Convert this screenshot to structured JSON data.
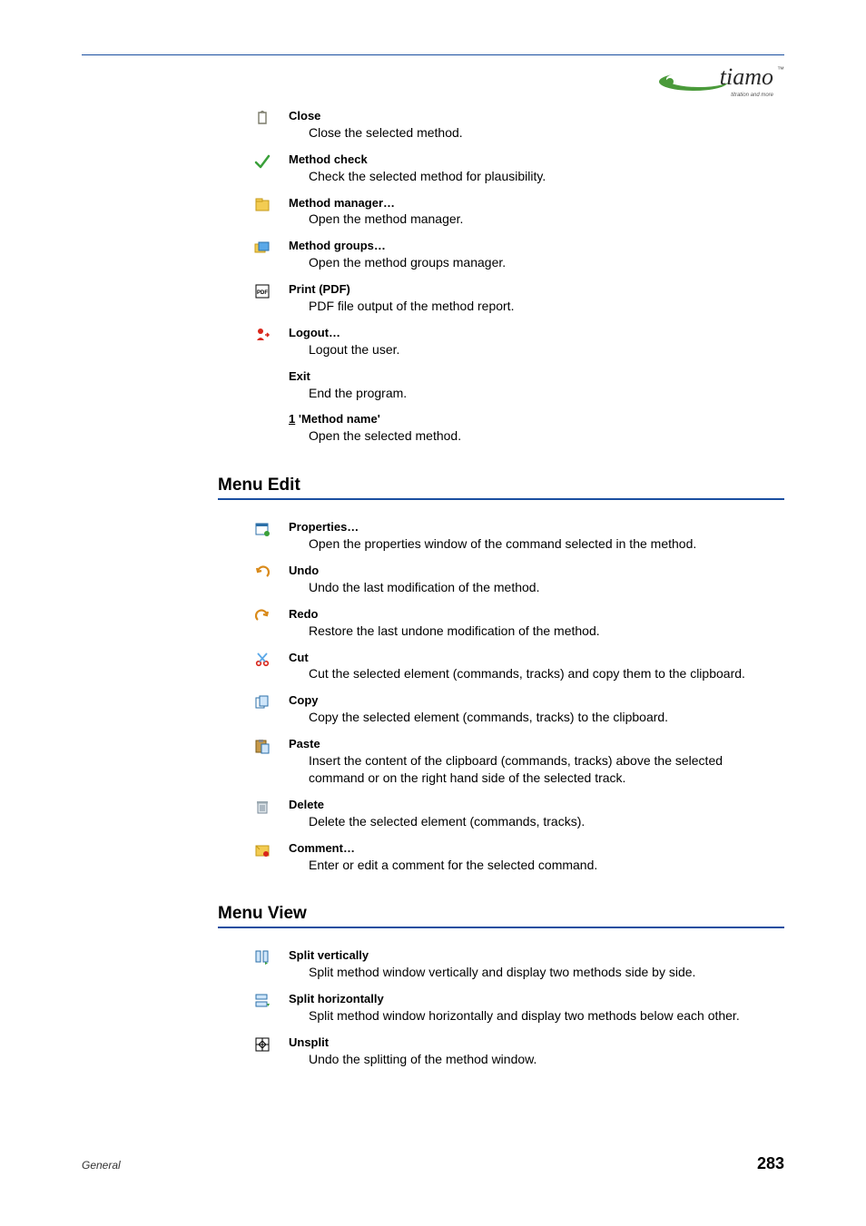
{
  "logo": {
    "text": "tiamo",
    "tm": "™",
    "sub": "titration and more"
  },
  "menu_file_extra": [
    {
      "icon": "close-icon",
      "title": "Close",
      "desc": "Close the selected method."
    },
    {
      "icon": "method-check-icon",
      "title": "Method check",
      "desc": "Check the selected method for plausibility."
    },
    {
      "icon": "method-manager-icon",
      "title": "Method manager…",
      "desc": "Open the method manager."
    },
    {
      "icon": "method-groups-icon",
      "title": "Method groups…",
      "desc": "Open the method groups manager."
    },
    {
      "icon": "pdf-icon",
      "title": "Print (PDF)",
      "desc": "PDF file output of the method report."
    },
    {
      "icon": "logout-icon",
      "title": "Logout…",
      "desc": "Logout the user."
    },
    {
      "icon": "",
      "title": "Exit",
      "desc": "End the program."
    },
    {
      "icon": "",
      "title_html": "1 'Method name'",
      "title_prefix": "1",
      "title_rest": " 'Method name'",
      "desc": "Open the selected method."
    }
  ],
  "menu_edit": {
    "heading": "Menu Edit",
    "items": [
      {
        "icon": "properties-icon",
        "title": "Properties…",
        "desc": "Open the properties window of the command selected in the method."
      },
      {
        "icon": "undo-icon",
        "title": "Undo",
        "desc": "Undo the last modification of the method."
      },
      {
        "icon": "redo-icon",
        "title": "Redo",
        "desc": "Restore the last undone modification of the method."
      },
      {
        "icon": "cut-icon",
        "title": "Cut",
        "desc": "Cut the selected element (commands, tracks) and copy them to the clipboard."
      },
      {
        "icon": "copy-icon",
        "title": "Copy",
        "desc": "Copy the selected element (commands, tracks) to the clipboard."
      },
      {
        "icon": "paste-icon",
        "title": "Paste",
        "desc": "Insert the content of the clipboard (commands, tracks) above the selected command or on the right hand side of the selected track."
      },
      {
        "icon": "delete-icon",
        "title": "Delete",
        "desc": "Delete the selected element (commands, tracks)."
      },
      {
        "icon": "comment-icon",
        "title": "Comment…",
        "desc": "Enter or edit a comment for the selected command."
      }
    ]
  },
  "menu_view": {
    "heading": "Menu View",
    "items": [
      {
        "icon": "split-vertical-icon",
        "title": "Split vertically",
        "desc": "Split method window vertically and display two methods side by side."
      },
      {
        "icon": "split-horizontal-icon",
        "title": "Split horizontally",
        "desc": "Split method window horizontally and display two methods below each other."
      },
      {
        "icon": "unsplit-icon",
        "title": "Unsplit",
        "desc": "Undo the splitting of the method window."
      }
    ]
  },
  "footer": {
    "left": "General",
    "page": "283"
  }
}
